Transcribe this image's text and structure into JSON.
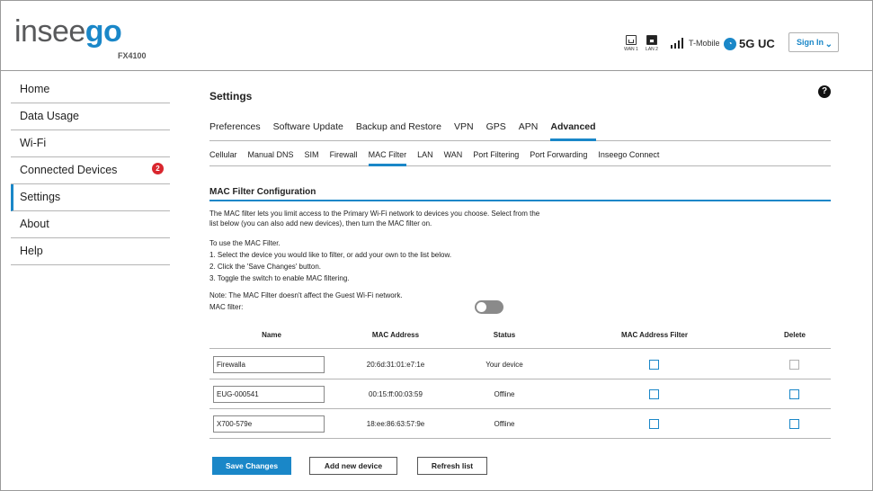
{
  "brand": {
    "name_part1": "insee",
    "name_part2": "go",
    "model": "FX4100",
    "accent": "#1a87c8",
    "alert": "#d9262e"
  },
  "header": {
    "ports": [
      {
        "label": "WAN 1",
        "icon": "ethernet-port-icon"
      },
      {
        "label": "LAN 2",
        "icon": "ethernet-port-icon"
      }
    ],
    "carrier": "T-Mobile",
    "network_icon": "5g-globe-icon",
    "network": "5G UC",
    "sign_in": "Sign In"
  },
  "sidebar": {
    "items": [
      {
        "label": "Home"
      },
      {
        "label": "Data Usage"
      },
      {
        "label": "Wi-Fi"
      },
      {
        "label": "Connected Devices",
        "badge": "2"
      },
      {
        "label": "Settings",
        "active": true
      },
      {
        "label": "About"
      },
      {
        "label": "Help"
      }
    ]
  },
  "main": {
    "title": "Settings",
    "help_icon": "?",
    "tabs": [
      "Preferences",
      "Software Update",
      "Backup and Restore",
      "VPN",
      "GPS",
      "APN",
      "Advanced"
    ],
    "active_tab": "Advanced",
    "subtabs": [
      "Cellular",
      "Manual DNS",
      "SIM",
      "Firewall",
      "MAC Filter",
      "LAN",
      "WAN",
      "Port Filtering",
      "Port Forwarding",
      "Inseego Connect"
    ],
    "active_subtab": "MAC Filter",
    "section_title": "MAC Filter Configuration",
    "intro": "The MAC filter lets you limit access to the Primary Wi-Fi network to devices you choose. Select from the list below (you can also add new devices), then turn the MAC filter on.",
    "steps_title": "To use the MAC Filter.",
    "steps": [
      "1. Select the device you would like to filter, or add your own to the list below.",
      "2. Click the 'Save Changes' button.",
      "3. Toggle the switch to enable MAC filtering."
    ],
    "note": "Note: The MAC Filter doesn't affect the Guest Wi-Fi network.",
    "mac_filter_label": "MAC filter:",
    "mac_filter_on": false
  },
  "table": {
    "headers": {
      "name": "Name",
      "mac": "MAC Address",
      "status": "Status",
      "filter": "MAC Address Filter",
      "delete": "Delete"
    },
    "rows": [
      {
        "name": "Firewalla",
        "mac": "20:6d:31:01:e7:1e",
        "status": "Your device",
        "filter": false,
        "delete": false,
        "delete_disabled": true
      },
      {
        "name": "EUG-000541",
        "mac": "00:15:ff:00:03:59",
        "status": "Offline",
        "filter": false,
        "delete": false,
        "delete_disabled": false
      },
      {
        "name": "X700-579e",
        "mac": "18:ee:86:63:57:9e",
        "status": "Offline",
        "filter": false,
        "delete": false,
        "delete_disabled": false
      }
    ]
  },
  "buttons": {
    "save": "Save Changes",
    "add": "Add new device",
    "refresh": "Refresh list"
  }
}
